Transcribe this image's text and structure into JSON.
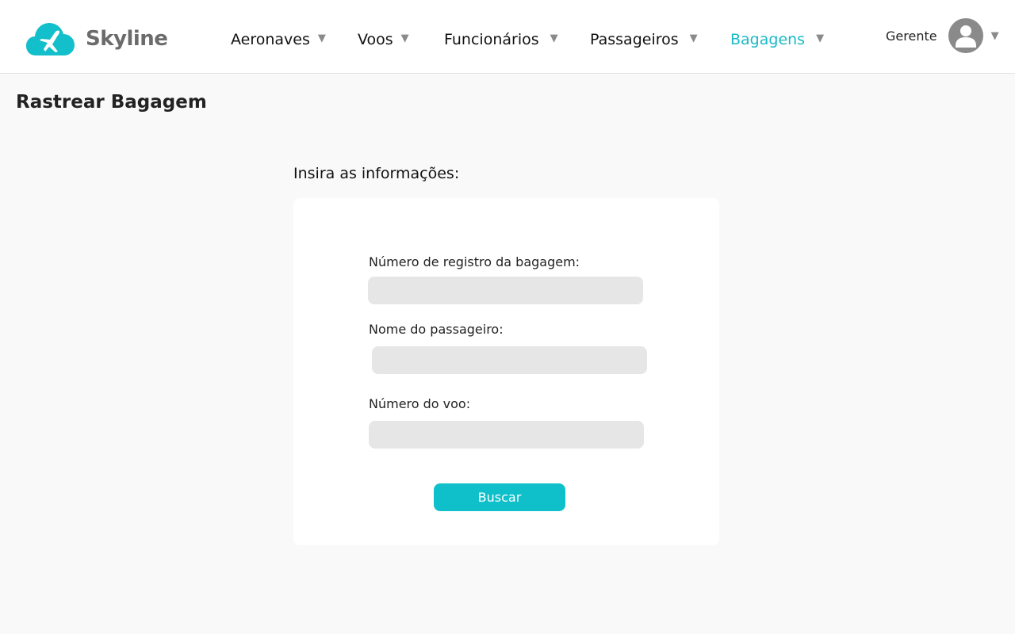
{
  "brand": {
    "name": "Skyline",
    "accent": "#0fbfca"
  },
  "nav": {
    "items": [
      {
        "label": "Aeronaves"
      },
      {
        "label": "Voos"
      },
      {
        "label": "Funcionários"
      },
      {
        "label": "Passageiros"
      },
      {
        "label": "Bagagens",
        "active": true
      }
    ],
    "caret_icon": "caret-down-icon"
  },
  "user": {
    "name": "Gerente",
    "avatar_icon": "user-avatar-icon"
  },
  "page": {
    "title": "Rastrear Bagagem"
  },
  "form": {
    "instructions": "Insira as informações:",
    "fields": [
      {
        "label": "Número de registro da bagagem:",
        "value": ""
      },
      {
        "label": "Nome do passageiro:",
        "value": ""
      },
      {
        "label": "Número do voo:",
        "value": ""
      }
    ],
    "submit_label": "Buscar"
  }
}
